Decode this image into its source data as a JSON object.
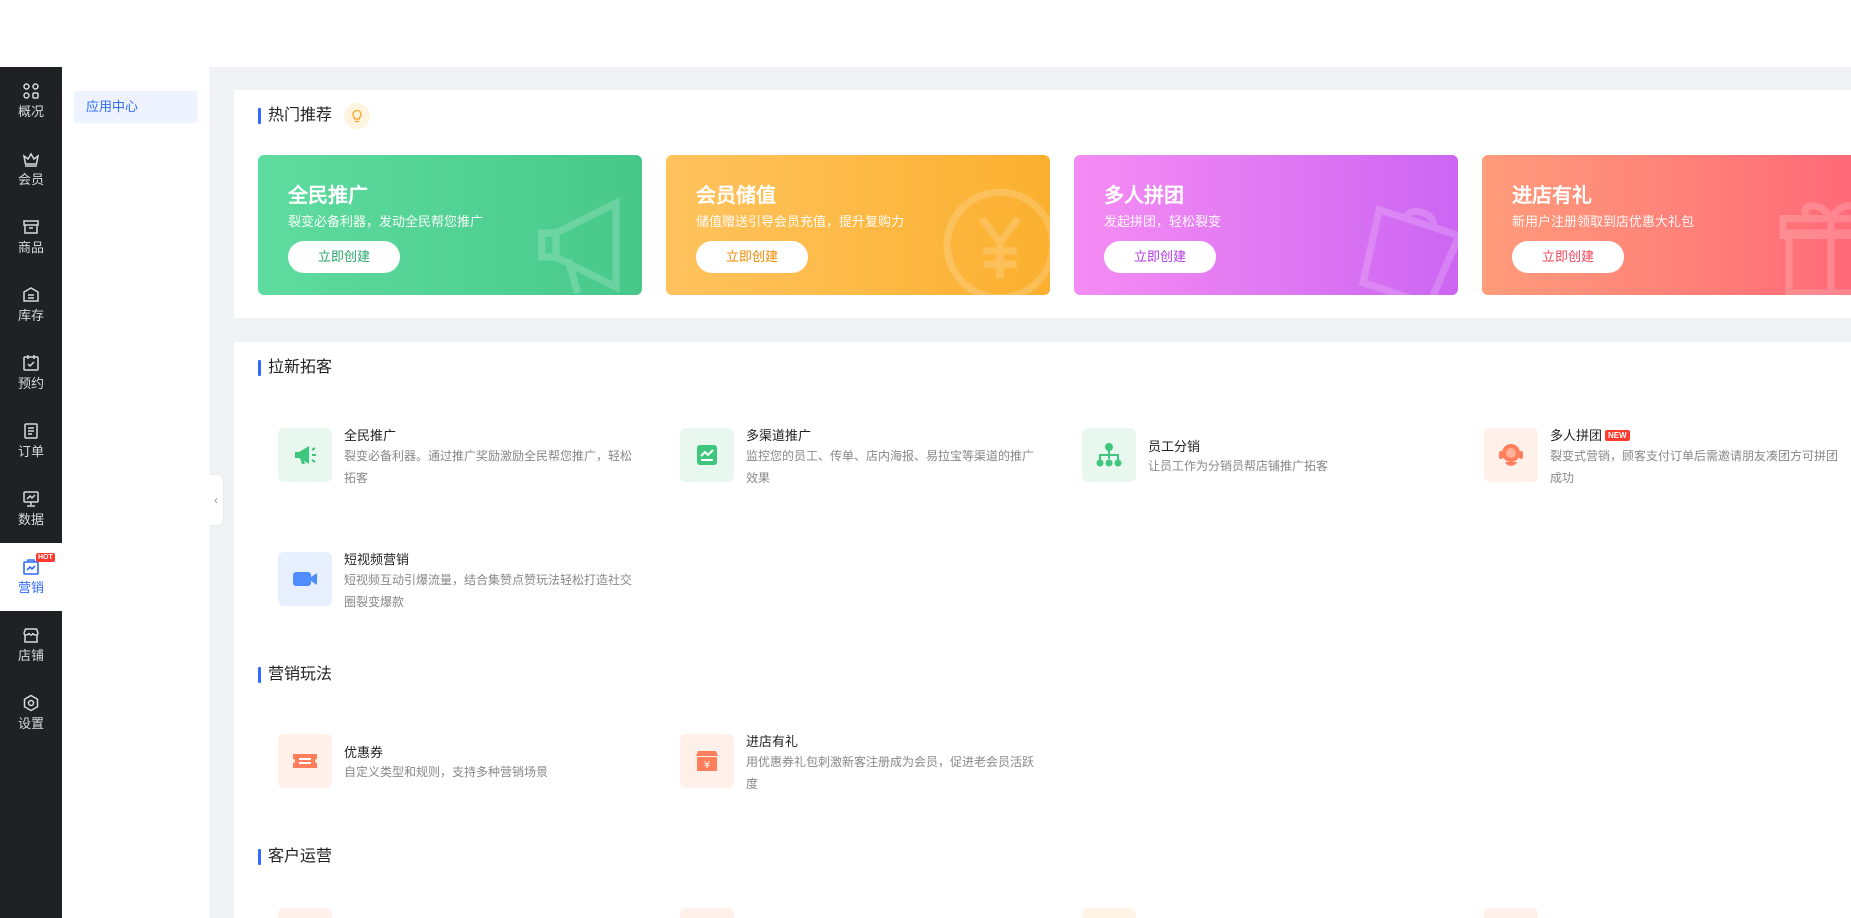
{
  "sidebar": {
    "items": [
      {
        "label": "概况",
        "icon": "grid-icon"
      },
      {
        "label": "会员",
        "icon": "crown-icon"
      },
      {
        "label": "商品",
        "icon": "store-icon"
      },
      {
        "label": "库存",
        "icon": "inventory-icon"
      },
      {
        "label": "预约",
        "icon": "calendar-check-icon"
      },
      {
        "label": "订单",
        "icon": "order-list-icon"
      },
      {
        "label": "数据",
        "icon": "chart-monitor-icon"
      },
      {
        "label": "营销",
        "icon": "marketing-icon",
        "badge": "HOT",
        "active": true
      },
      {
        "label": "店铺",
        "icon": "shop-icon"
      },
      {
        "label": "设置",
        "icon": "settings-icon"
      }
    ]
  },
  "subnav": {
    "item": "应用中心"
  },
  "hot": {
    "title": "热门推荐",
    "icon": "lightbulb-icon",
    "cards": [
      {
        "title": "全民推广",
        "desc": "裂变必备利器，发动全民帮您推广",
        "button": "立即创建",
        "color": "#4fd094"
      },
      {
        "title": "会员储值",
        "desc": "储值赠送引导会员充值，提升复购力",
        "button": "立即创建",
        "color": "#fdb944"
      },
      {
        "title": "多人拼团",
        "desc": "发起拼团，轻松裂变",
        "button": "立即创建",
        "color": "#de78f3"
      },
      {
        "title": "进店有礼",
        "desc": "新用户注册领取到店优惠大礼包",
        "button": "立即创建",
        "color": "#ff8078"
      }
    ]
  },
  "sections": {
    "acquire": {
      "title": "拉新拓客",
      "apps": [
        {
          "name": "全民推广",
          "desc": "裂变必备利器。通过推广奖励激励全民帮您推广，轻松拓客",
          "icon": "megaphone-icon"
        },
        {
          "name": "多渠道推广",
          "desc": "监控您的员工、传单、店内海报、易拉宝等渠道的推广效果",
          "icon": "channel-chart-icon"
        },
        {
          "name": "员工分销",
          "desc": "让员工作为分销员帮店铺推广拓客",
          "icon": "org-tree-icon"
        },
        {
          "name": "多人拼团",
          "badge": "NEW",
          "desc": "裂变式营销，顾客支付订单后需邀请朋友凑团方可拼团成功",
          "icon": "group-buy-icon"
        },
        {
          "name": "短视频营销",
          "desc": "短视频互动引爆流量，结合集赞点赞玩法轻松打造社交圈裂变爆款",
          "icon": "video-camera-icon"
        }
      ]
    },
    "play": {
      "title": "营销玩法",
      "apps": [
        {
          "name": "优惠券",
          "desc": "自定义类型和规则，支持多种营销场景",
          "icon": "coupon-icon"
        },
        {
          "name": "进店有礼",
          "desc": "用优惠券礼包刺激新客注册成为会员，促进老会员活跃度",
          "icon": "store-gift-icon"
        }
      ]
    },
    "ops": {
      "title": "客户运营"
    }
  }
}
